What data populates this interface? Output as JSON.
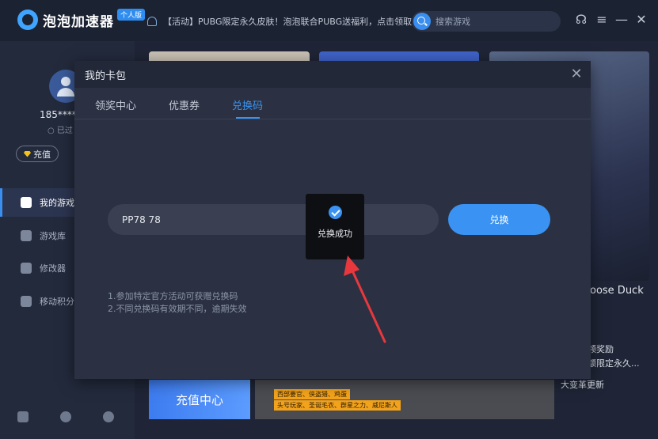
{
  "app": {
    "name": "泡泡加速器",
    "edition_badge": "个人版"
  },
  "notice": {
    "text": "【活动】PUBG限定永久皮肤！泡泡联合PUBG送福利，点击领取。"
  },
  "search": {
    "placeholder": "搜索游戏"
  },
  "user": {
    "name": "185****8",
    "status": "已过",
    "recharge_label": "充值"
  },
  "sidebar": {
    "items": [
      {
        "label": "我的游戏",
        "active": true,
        "icon": "rocket-icon"
      },
      {
        "label": "游戏库",
        "active": false,
        "icon": "gamepad-icon"
      },
      {
        "label": "修改器",
        "active": false,
        "icon": "cat-icon"
      },
      {
        "label": "移动积分",
        "active": false,
        "icon": "coin-icon"
      }
    ]
  },
  "background": {
    "game_title": "oose Duck",
    "side_lines": [
      "领奖励",
      "额限定永久...",
      "大变革更新"
    ],
    "recharge_banner": "充值中心",
    "promo_tags": [
      "西部要官、侠盗猎、鸡蛋",
      "头号玩家、圣诞毛衣、群星之力、威尼斯人"
    ]
  },
  "modal": {
    "title": "我的卡包",
    "tabs": [
      {
        "label": "领奖中心",
        "active": false
      },
      {
        "label": "优惠券",
        "active": false
      },
      {
        "label": "兑换码",
        "active": true
      }
    ],
    "code_value": "PP78 78",
    "redeem_label": "兑换",
    "toast": "兑换成功",
    "notes": [
      "1.参加特定官方活动可获赠兑换码",
      "2.不同兑换码有效期不同，逾期失效"
    ]
  },
  "colors": {
    "accent": "#3a93f2",
    "background": "#1f2536",
    "modal": "#2b3142",
    "annotation_arrow": "#e8383d"
  }
}
